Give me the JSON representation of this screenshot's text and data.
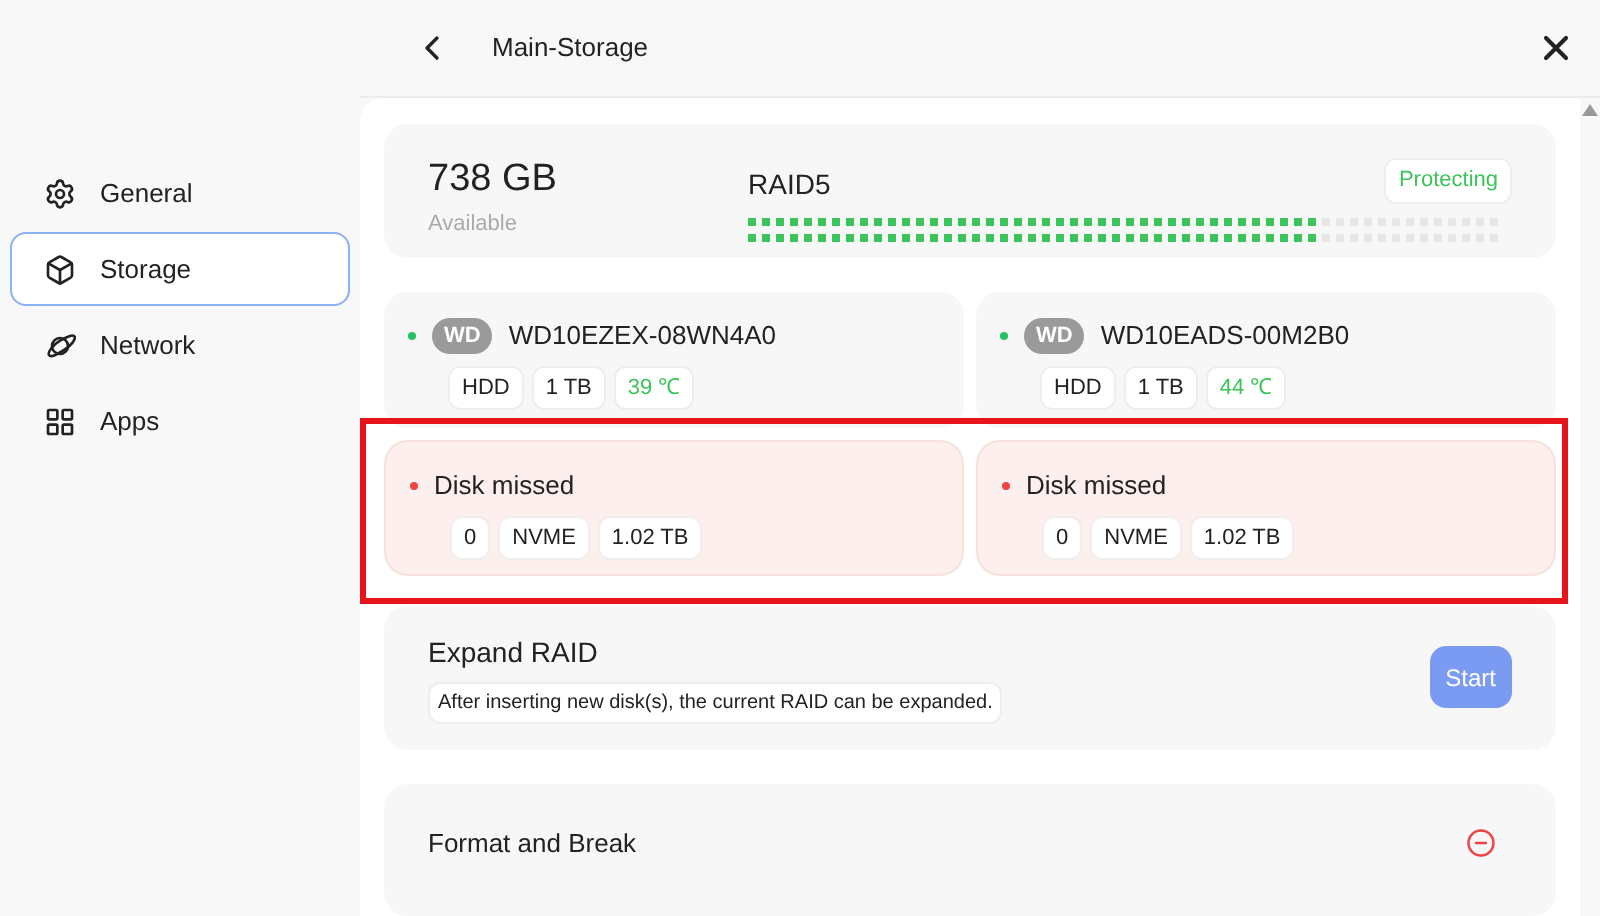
{
  "sidebar": {
    "items": [
      {
        "label": "General",
        "selected": false
      },
      {
        "label": "Storage",
        "selected": true
      },
      {
        "label": "Network",
        "selected": false
      },
      {
        "label": "Apps",
        "selected": false
      }
    ]
  },
  "header": {
    "title": "Main-Storage"
  },
  "summary": {
    "capacity": "738 GB",
    "capacity_label": "Available",
    "raid": "RAID5",
    "status": "Protecting"
  },
  "disks": [
    {
      "kind": "present",
      "color": "#22c55e",
      "logo": "WD",
      "name": "WD10EZEX-08WN4A0",
      "tags": [
        "HDD",
        "1 TB"
      ],
      "temperature": "39 ℃"
    },
    {
      "kind": "present",
      "color": "#22c55e",
      "logo": "WD",
      "name": "WD10EADS-00M2B0",
      "tags": [
        "HDD",
        "1 TB"
      ],
      "temperature": "44 ℃"
    },
    {
      "kind": "missing",
      "color": "#ef4444",
      "name": "Disk missed",
      "tags": [
        "0",
        "NVME",
        "1.02 TB"
      ]
    },
    {
      "kind": "missing",
      "color": "#ef4444",
      "name": "Disk missed",
      "tags": [
        "0",
        "NVME",
        "1.02 TB"
      ]
    }
  ],
  "expand": {
    "title": "Expand RAID",
    "description": "After inserting new disk(s), the current RAID can be expanded.",
    "button": "Start"
  },
  "format": {
    "title": "Format and Break"
  }
}
